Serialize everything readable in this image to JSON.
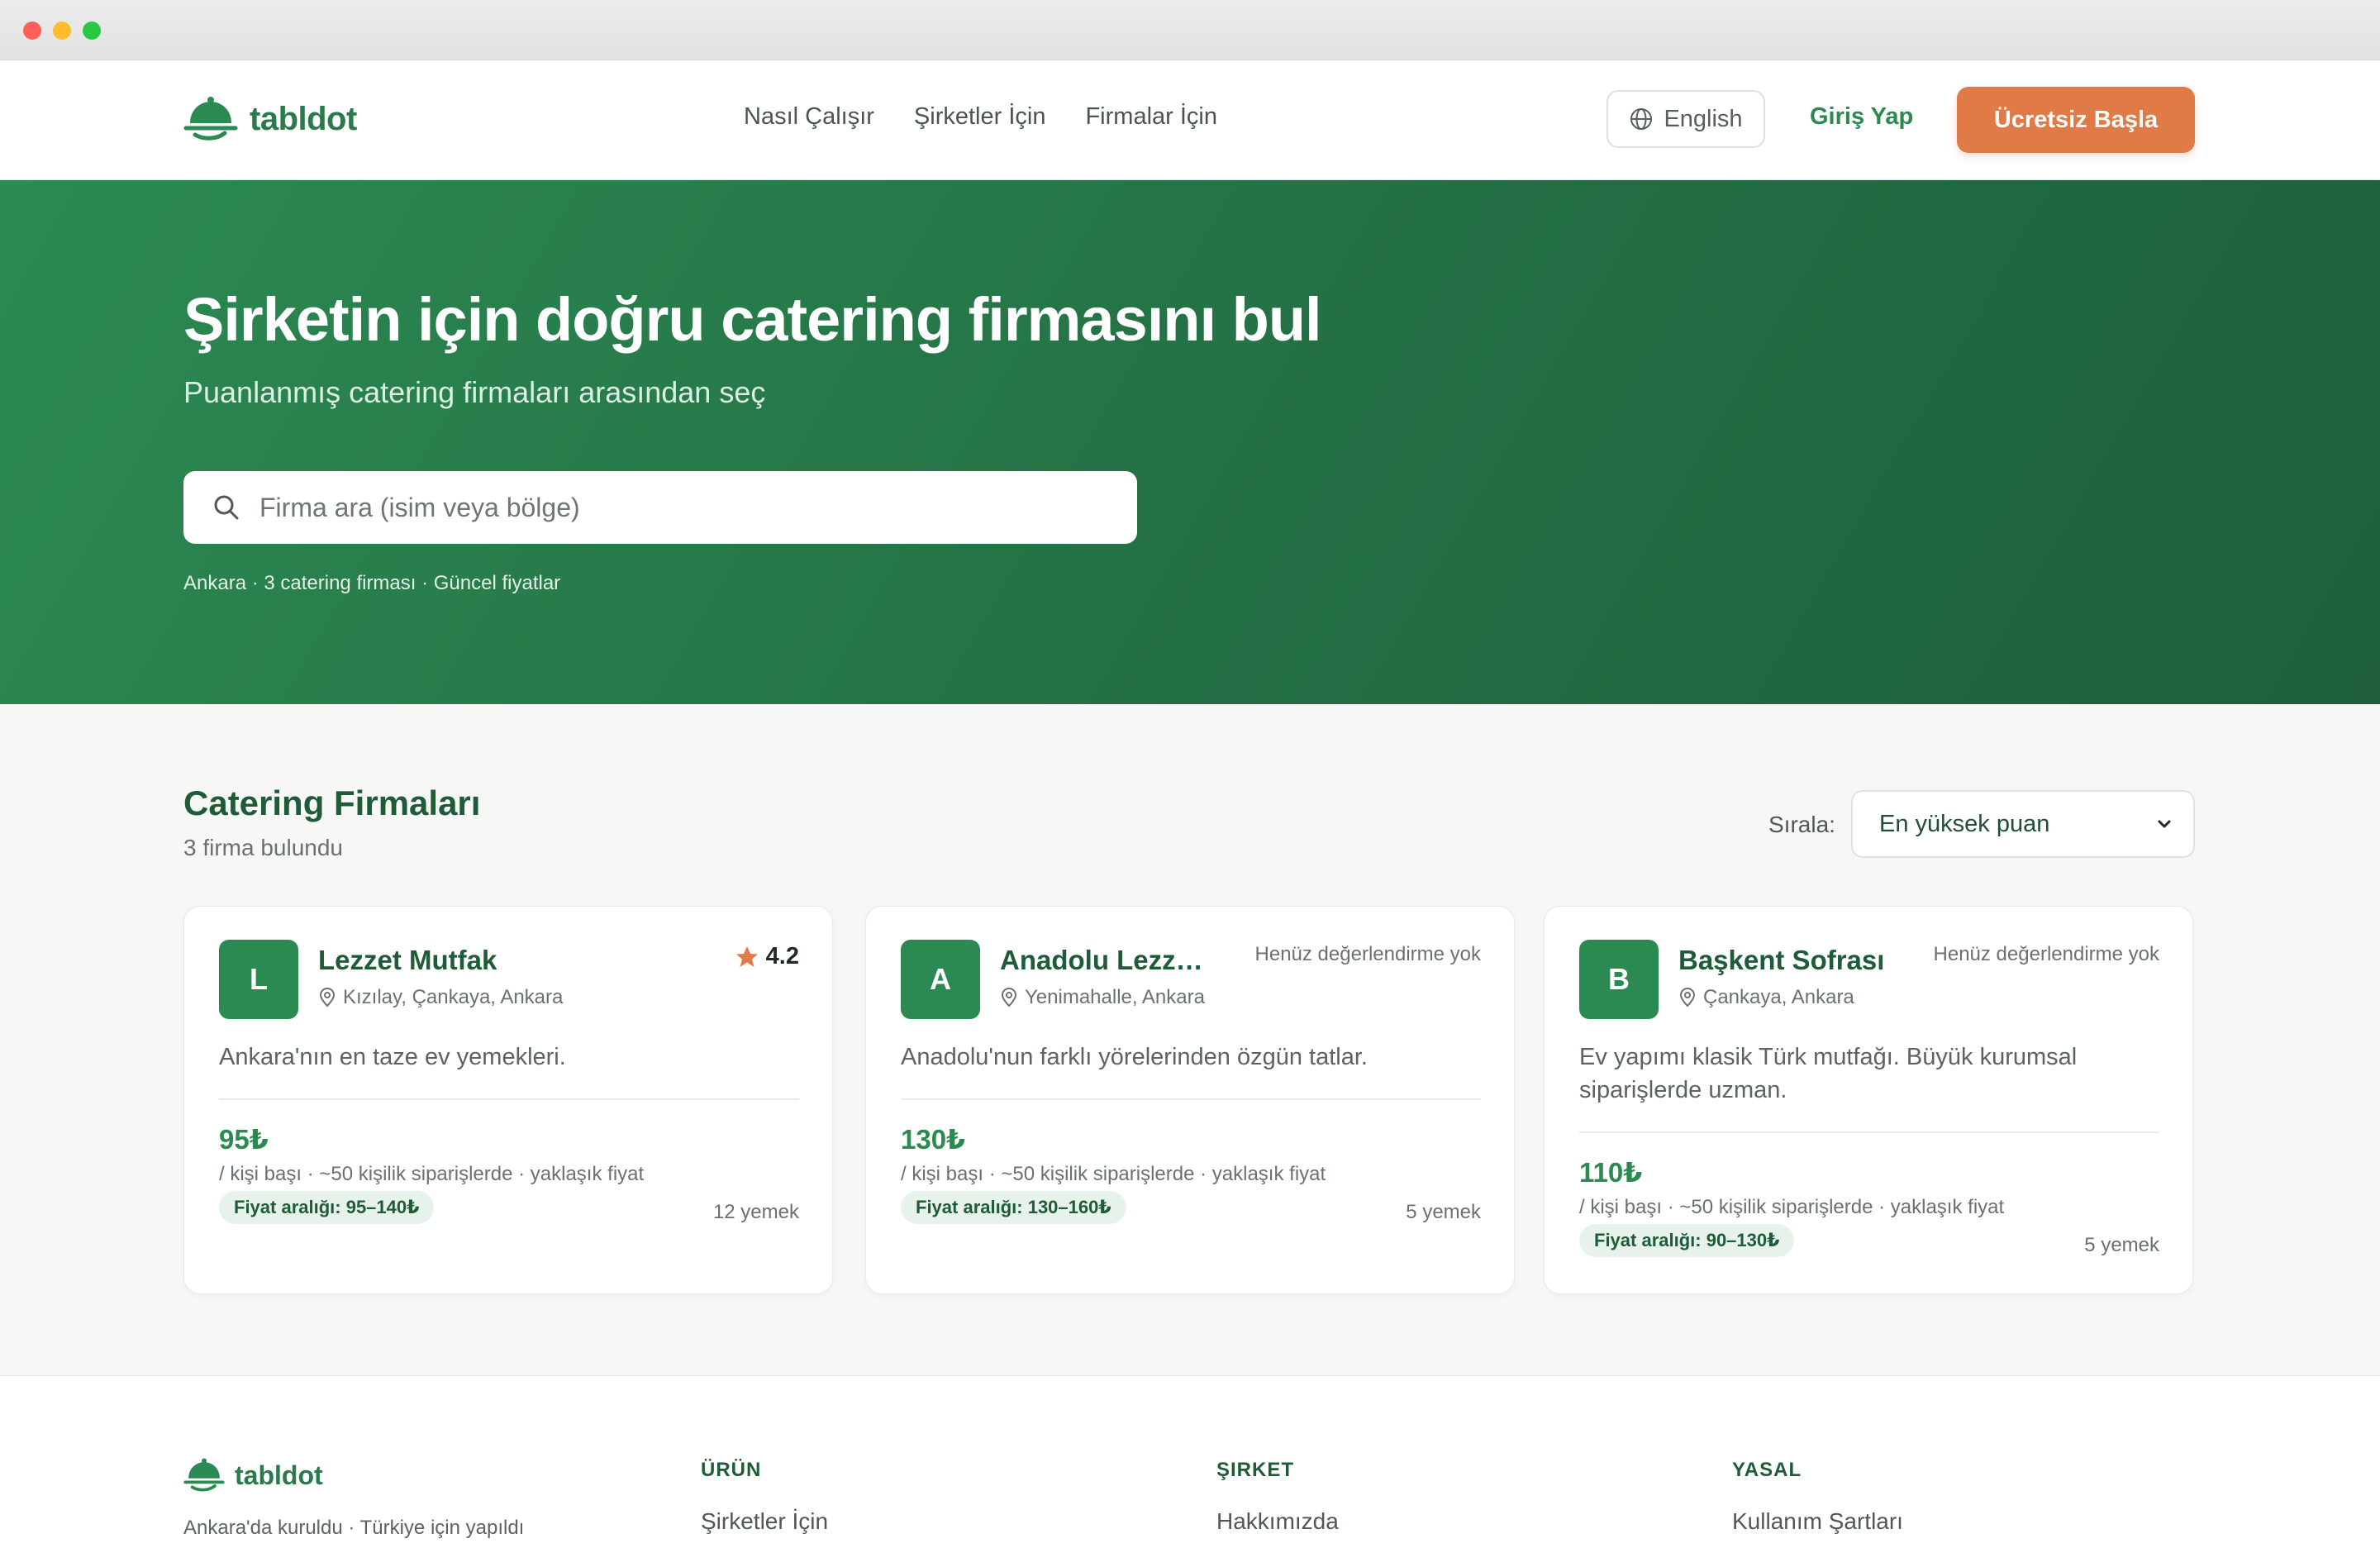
{
  "header": {
    "logo_text": "tabldot",
    "nav": [
      "Nasıl Çalışır",
      "Şirketler İçin",
      "Firmalar İçin"
    ],
    "language_label": "English",
    "login_label": "Giriş Yap",
    "cta_label": "Ücretsiz Başla"
  },
  "hero": {
    "title": "Şirketin için doğru catering firmasını bul",
    "subtitle": "Puanlanmış catering firmaları arasından seç",
    "search_placeholder": "Firma ara (isim veya bölge)",
    "meta": "Ankara · 3 catering firması · Güncel fiyatlar"
  },
  "main": {
    "title": "Catering Firmaları",
    "count": "3 firma bulundu",
    "sort_label": "Sırala:",
    "sort_value": "En yüksek puan",
    "cards": [
      {
        "initial": "L",
        "name": "Lezzet Mutfak",
        "location": "Kızılay, Çankaya, Ankara",
        "rating": "4.2",
        "description": "Ankara'nın en taze ev yemekleri.",
        "price": "95₺",
        "unit": "/ kişi başı · ~50 kişilik siparişlerde · yaklaşık fiyat",
        "range": "Fiyat aralığı: 95–140₺",
        "dishes": "12 yemek"
      },
      {
        "initial": "A",
        "name": "Anadolu Lezzetleri",
        "location": "Yenimahalle, Ankara",
        "no_rating": "Henüz değerlendirme yok",
        "description": "Anadolu'nun farklı yörelerinden özgün tatlar.",
        "price": "130₺",
        "unit": "/ kişi başı · ~50 kişilik siparişlerde · yaklaşık fiyat",
        "range": "Fiyat aralığı: 130–160₺",
        "dishes": "5 yemek"
      },
      {
        "initial": "B",
        "name": "Başkent Sofrası",
        "location": "Çankaya, Ankara",
        "no_rating": "Henüz değerlendirme yok",
        "description": "Ev yapımı klasik Türk mutfağı. Büyük kurumsal siparişlerde uzman.",
        "price": "110₺",
        "unit": "/ kişi başı · ~50 kişilik siparişlerde · yaklaşık fiyat",
        "range": "Fiyat aralığı: 90–130₺",
        "dishes": "5 yemek"
      }
    ]
  },
  "footer": {
    "logo_text": "tabldot",
    "tagline": "Ankara'da kuruldu · Türkiye için yapıldı",
    "columns": [
      {
        "heading": "ÜRÜN",
        "link": "Şirketler İçin"
      },
      {
        "heading": "ŞIRKET",
        "link": "Hakkımızda"
      },
      {
        "heading": "YASAL",
        "link": "Kullanım Şartları"
      }
    ]
  },
  "colors": {
    "brand_green": "#2a8a52",
    "dark_green": "#1d5c37",
    "accent_orange": "#e07a46"
  },
  "icons": [
    "logo-cloche-icon",
    "globe-icon",
    "search-icon",
    "location-pin-icon",
    "star-icon",
    "chevron-down-icon"
  ]
}
